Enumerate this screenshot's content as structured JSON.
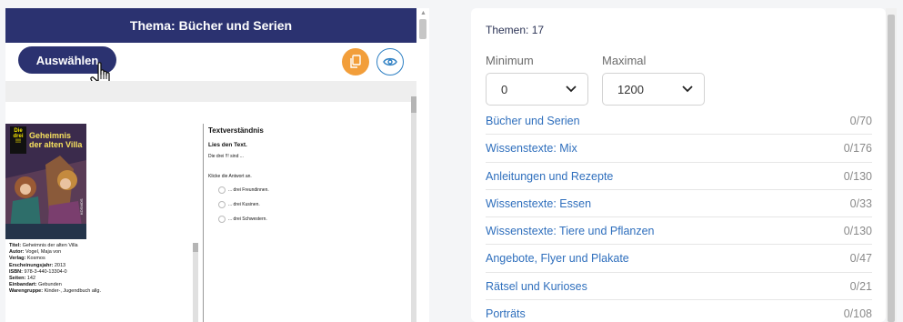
{
  "left_panel": {
    "header_title": "Thema: Bücher und Serien",
    "select_button_label": "Auswählen",
    "icons": {
      "copy": "copy-icon",
      "preview": "eye-icon",
      "cursor": "hand-cursor-icon"
    },
    "worksheet": {
      "book": {
        "badge": "Die drei !!!",
        "cover_title": "Geheimnis der alten Villa",
        "publisher": "KOSMOS",
        "details": [
          {
            "label": "Titel:",
            "value": "Geheimnis der alten Villa"
          },
          {
            "label": "Autor:",
            "value": "Vogel, Maja von"
          },
          {
            "label": "Verlag:",
            "value": "Kosmos"
          },
          {
            "label": "Erscheinungsjahr:",
            "value": "2013"
          },
          {
            "label": "ISBN:",
            "value": "978-3-440-13304-0"
          },
          {
            "label": "Seiten:",
            "value": "142"
          },
          {
            "label": "Einbandart:",
            "value": "Gebunden"
          },
          {
            "label": "Warengruppe:",
            "value": "Kinder-, Jugendbuch allg."
          }
        ]
      },
      "task": {
        "title": "Textverständnis",
        "instruction": "Lies den Text.",
        "sentence": "Die drei !!! sind ...",
        "prompt": "Klicke die Antwort an.",
        "options": [
          "... drei Freundinnen.",
          "... drei Kusinen.",
          "... drei Schwestern."
        ]
      }
    }
  },
  "right_panel": {
    "topics_count": "Themen: 17",
    "minimum_label": "Minimum",
    "maximum_label": "Maximal",
    "minimum_value": "0",
    "maximum_value": "1200",
    "topics": [
      {
        "name": "Bücher und Serien",
        "count": "0/70"
      },
      {
        "name": "Wissenstexte: Mix",
        "count": "0/176"
      },
      {
        "name": "Anleitungen und Rezepte",
        "count": "0/130"
      },
      {
        "name": "Wissenstexte: Essen",
        "count": "0/33"
      },
      {
        "name": "Wissenstexte: Tiere und Pflanzen",
        "count": "0/130"
      },
      {
        "name": "Angebote, Flyer und Plakate",
        "count": "0/47"
      },
      {
        "name": "Rätsel und Kurioses",
        "count": "0/21"
      },
      {
        "name": "Porträts",
        "count": "0/108"
      }
    ]
  },
  "colors": {
    "header": "#2b3270",
    "accent_orange": "#f29e3a",
    "link_blue": "#2f6fbd"
  }
}
